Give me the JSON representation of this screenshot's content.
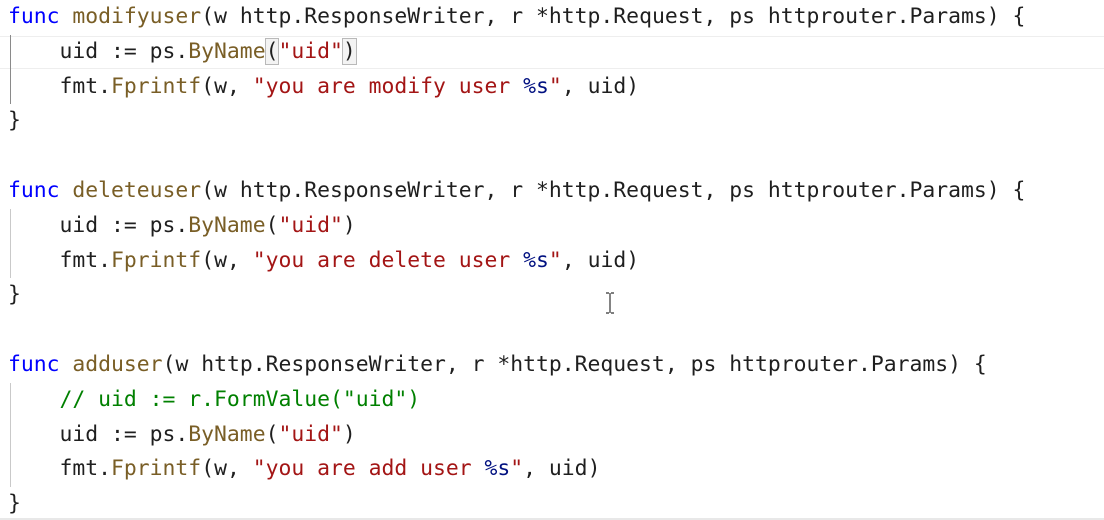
{
  "code": {
    "lines": [
      [
        {
          "t": "func",
          "c": "kw"
        },
        {
          "t": " "
        },
        {
          "t": "modifyuser",
          "c": "fn"
        },
        {
          "t": "(w http.ResponseWriter, r *http.Request, ps httprouter.Params) {"
        }
      ],
      [
        {
          "t": "    uid := ps."
        },
        {
          "t": "ByName",
          "c": "fn"
        },
        {
          "t": "(",
          "c": "bm"
        },
        {
          "t": "\"uid\"",
          "c": "str"
        },
        {
          "t": ")",
          "c": "bm"
        }
      ],
      [
        {
          "t": "    fmt."
        },
        {
          "t": "Fprintf",
          "c": "fn"
        },
        {
          "t": "(w, "
        },
        {
          "t": "\"you are modify user ",
          "c": "str"
        },
        {
          "t": "%s",
          "c": "fmt"
        },
        {
          "t": "\"",
          "c": "str"
        },
        {
          "t": ", uid)"
        }
      ],
      [
        {
          "t": "}"
        }
      ],
      [],
      [
        {
          "t": "func",
          "c": "kw"
        },
        {
          "t": " "
        },
        {
          "t": "deleteuser",
          "c": "fn"
        },
        {
          "t": "(w http.ResponseWriter, r *http.Request, ps httprouter.Params) {"
        }
      ],
      [
        {
          "t": "    uid := ps."
        },
        {
          "t": "ByName",
          "c": "fn"
        },
        {
          "t": "("
        },
        {
          "t": "\"uid\"",
          "c": "str"
        },
        {
          "t": ")"
        }
      ],
      [
        {
          "t": "    fmt."
        },
        {
          "t": "Fprintf",
          "c": "fn"
        },
        {
          "t": "(w, "
        },
        {
          "t": "\"you are delete user ",
          "c": "str"
        },
        {
          "t": "%s",
          "c": "fmt"
        },
        {
          "t": "\"",
          "c": "str"
        },
        {
          "t": ", uid)"
        }
      ],
      [
        {
          "t": "}"
        }
      ],
      [],
      [
        {
          "t": "func",
          "c": "kw"
        },
        {
          "t": " "
        },
        {
          "t": "adduser",
          "c": "fn"
        },
        {
          "t": "(w http.ResponseWriter, r *http.Request, ps httprouter.Params) {"
        }
      ],
      [
        {
          "t": "    "
        },
        {
          "t": "// uid := r.FormValue(\"uid\")",
          "c": "cm"
        }
      ],
      [
        {
          "t": "    uid := ps."
        },
        {
          "t": "ByName",
          "c": "fn"
        },
        {
          "t": "("
        },
        {
          "t": "\"uid\"",
          "c": "str"
        },
        {
          "t": ")"
        }
      ],
      [
        {
          "t": "    fmt."
        },
        {
          "t": "Fprintf",
          "c": "fn"
        },
        {
          "t": "(w, "
        },
        {
          "t": "\"you are add user ",
          "c": "str"
        },
        {
          "t": "%s",
          "c": "fmt"
        },
        {
          "t": "\"",
          "c": "str"
        },
        {
          "t": ", uid)"
        }
      ],
      [
        {
          "t": "}"
        }
      ]
    ],
    "current_line": 1,
    "indent_guides": [
      {
        "from": 1,
        "to": 2,
        "active": true
      },
      {
        "from": 6,
        "to": 7,
        "active": false
      },
      {
        "from": 11,
        "to": 13,
        "active": false
      }
    ]
  },
  "colors": {
    "keyword": "#0000ff",
    "function": "#795e26",
    "string": "#a31515",
    "comment": "#008000",
    "format_verb": "#001080",
    "text": "#1f1f1f",
    "background": "#ffffff"
  },
  "cursor": {
    "icon": "i-beam-cursor-icon"
  }
}
